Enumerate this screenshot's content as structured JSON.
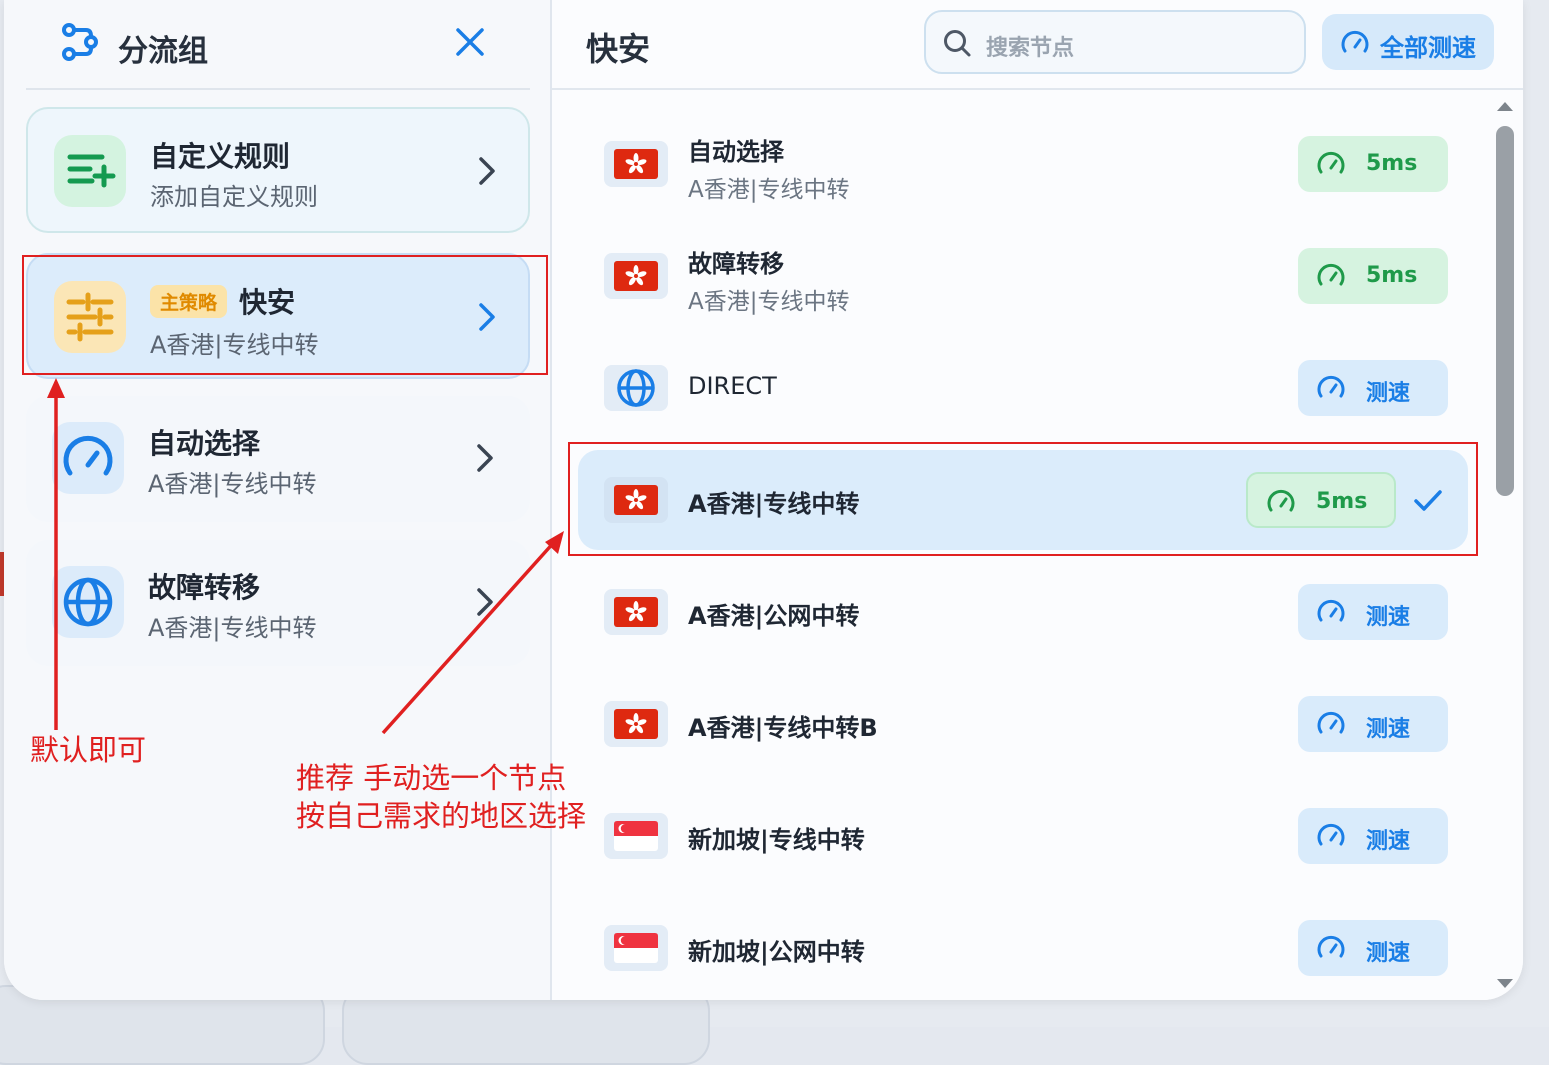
{
  "left_panel": {
    "title": "分流组",
    "items": [
      {
        "title": "自定义规则",
        "subtitle": "添加自定义规则"
      },
      {
        "badge": "主策略",
        "title": "快安",
        "subtitle": "A香港|专线中转"
      },
      {
        "title": "自动选择",
        "subtitle": "A香港|专线中转"
      },
      {
        "title": "故障转移",
        "subtitle": "A香港|专线中转"
      }
    ]
  },
  "right_panel": {
    "title": "快安",
    "search_placeholder": "搜索节点",
    "speed_all_label": "全部测速",
    "nodes": [
      {
        "name": "自动选择",
        "sub": "A香港|专线中转",
        "flag": "hk-flag-icon",
        "action": "5ms"
      },
      {
        "name": "故障转移",
        "sub": "A香港|专线中转",
        "flag": "hk-flag-icon",
        "action": "5ms"
      },
      {
        "name": "DIRECT",
        "flag": "globe-icon",
        "action": "测速"
      },
      {
        "name": "A香港|专线中转",
        "flag": "hk-flag-icon",
        "action": "5ms",
        "selected": true
      },
      {
        "name": "A香港|公网中转",
        "flag": "hk-flag-icon",
        "action": "测速"
      },
      {
        "name": "A香港|专线中转B",
        "flag": "hk-flag-icon",
        "action": "测速"
      },
      {
        "name": "新加坡|专线中转",
        "flag": "sg-flag-icon",
        "action": "测速"
      },
      {
        "name": "新加坡|公网中转",
        "flag": "sg-flag-icon",
        "action": "测速"
      }
    ]
  },
  "annotations": {
    "left_note": "默认即可",
    "right_note_line1": "推荐 手动选一个节点",
    "right_note_line2": "按自己需求的地区选择"
  },
  "colors": {
    "accent": "#1a7ee6",
    "latency_ok": "#1f9a4a",
    "annotation": "#e02020",
    "badge": "#e08a00"
  }
}
